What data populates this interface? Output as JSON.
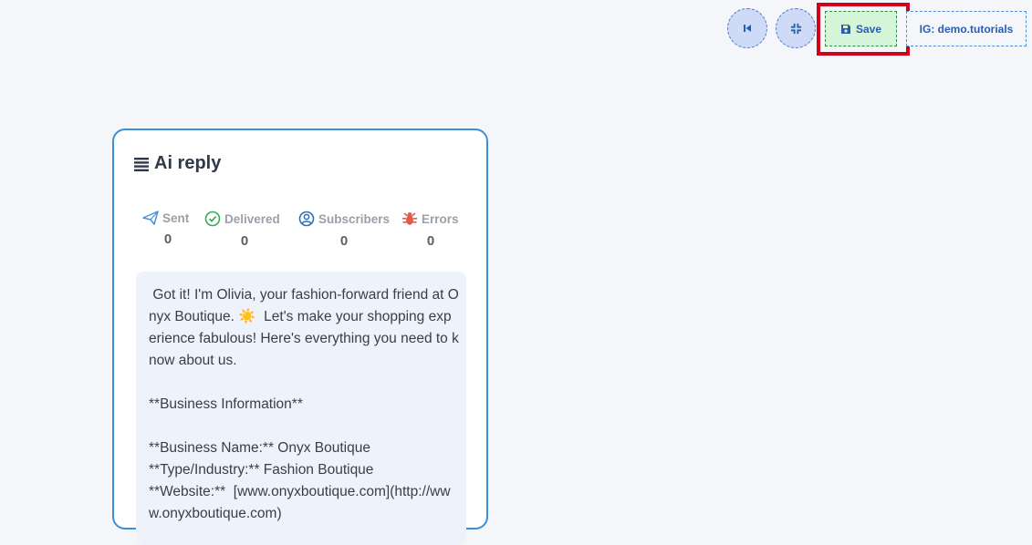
{
  "toolbar": {
    "save_label": "Save",
    "account_label": "IG: demo.tutorials"
  },
  "icons": {
    "first": "skip-back-icon",
    "compress": "compress-icon",
    "save": "floppy-disk-icon",
    "title": "list-icon",
    "sent": "paper-plane-icon",
    "delivered": "check-circle-icon",
    "subscribers": "user-circle-icon",
    "errors": "bug-icon"
  },
  "colors": {
    "accent": "#3b8fd8",
    "highlight": "#d0021b",
    "save_bg": "#d4f5d8",
    "error": "#e05a4a",
    "delivered": "#3aaa55"
  },
  "card": {
    "title": "Ai reply",
    "stats": [
      {
        "label": "Sent",
        "value": "0"
      },
      {
        "label": "Delivered",
        "value": "0"
      },
      {
        "label": "Subscribers",
        "value": "0"
      },
      {
        "label": "Errors",
        "value": "0"
      }
    ],
    "reply": {
      "line1": " Got it! I'm Olivia, your fashion-forward friend at Onyx Boutique. ☀️  Let's make your shopping experience fabulous! Here's everything you need to know about us.",
      "line2": "**Business Information**",
      "line3": "**Business Name:** Onyx Boutique\n**Type/Industry:** Fashion Boutique\n**Website:**  [www.onyxboutique.com](http://www.onyxboutique.com)"
    }
  }
}
